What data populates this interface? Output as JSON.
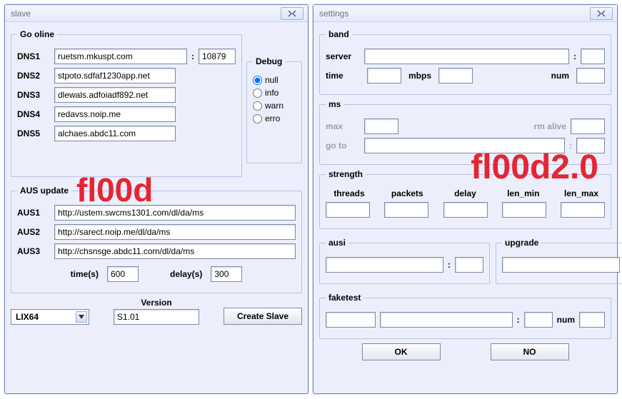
{
  "left": {
    "title": "slave",
    "watermark": "fl00d",
    "go_online": {
      "legend": "Go oline",
      "rows": [
        {
          "label": "DNS1",
          "value": "ruetsm.mkuspt.com"
        },
        {
          "label": "DNS2",
          "value": "stpoto.sdfaf1230app.net"
        },
        {
          "label": "DNS3",
          "value": "dlewals.adfoiadf892.net"
        },
        {
          "label": "DNS4",
          "value": "redavss.noip.me"
        },
        {
          "label": "DNS5",
          "value": "alchaes.abdc11.com"
        }
      ],
      "port_sep": ":",
      "port": "10879"
    },
    "debug": {
      "legend": "Debug",
      "options": [
        "null",
        "info",
        "warn",
        "erro"
      ],
      "selected": "null"
    },
    "aus": {
      "legend": "AUS update",
      "rows": [
        {
          "label": "AUS1",
          "value": "http://ustem.swcms1301.com/dl/da/ms"
        },
        {
          "label": "AUS2",
          "value": "http://sarect.noip.me/dl/da/ms"
        },
        {
          "label": "AUS3",
          "value": "http://chsnsge.abdc11.com/dl/da/ms"
        }
      ],
      "time_label": "time(s)",
      "time_value": "600",
      "delay_label": "delay(s)",
      "delay_value": "300"
    },
    "footer": {
      "version_label": "Version",
      "arch": "LIX64",
      "version": "S1.01",
      "create_label": "Create Slave"
    }
  },
  "right": {
    "title": "settings",
    "watermark": "fl00d2.0",
    "band": {
      "legend": "band",
      "server_label": "server",
      "sep": ":",
      "time_label": "time",
      "mbps_label": "mbps",
      "num_label": "num"
    },
    "ms": {
      "legend": "ms",
      "max_label": "max",
      "rm_alive_label": "rm alive",
      "goto_label": "go to",
      "sep": ":"
    },
    "strength": {
      "legend": "strength",
      "cols": [
        "threads",
        "packets",
        "delay",
        "len_min",
        "len_max"
      ]
    },
    "ausi": {
      "legend": "ausi",
      "sep": ":"
    },
    "upgrade": {
      "legend": "upgrade"
    },
    "faketest": {
      "legend": "faketest",
      "sep": ":",
      "num_label": "num"
    },
    "buttons": {
      "ok": "OK",
      "no": "NO"
    }
  }
}
